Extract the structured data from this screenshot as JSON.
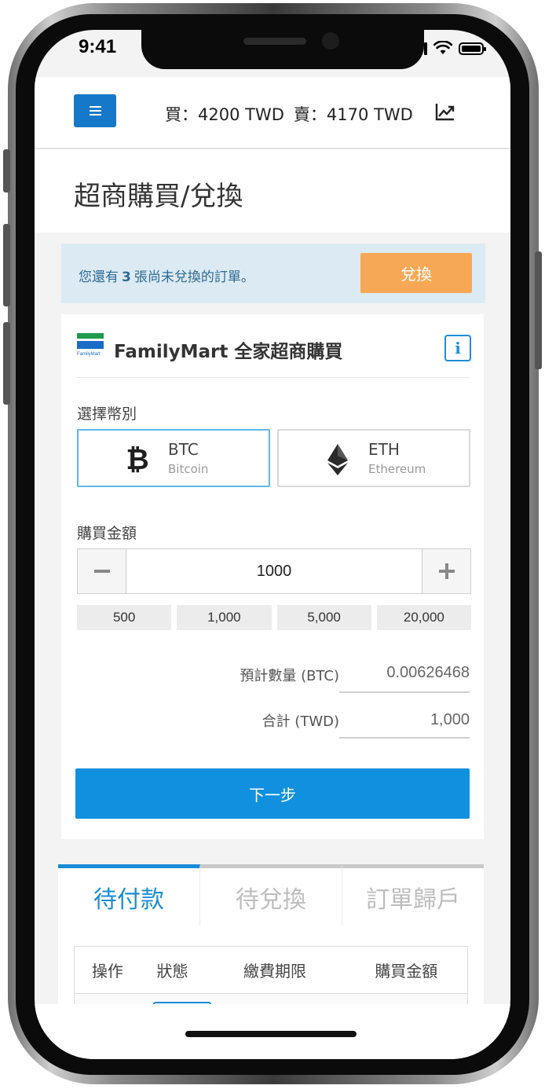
{
  "status_bar": {
    "time": "9:41"
  },
  "header": {
    "buy_rate": "買：4200 TWD",
    "sell_rate": "賣：4170 TWD"
  },
  "page": {
    "title": "超商購買/兌換"
  },
  "alert": {
    "text_before": "您還有",
    "count": "3",
    "text_after": "張尚未兌換的訂單。",
    "exchange_label": "兌換"
  },
  "card": {
    "logo_text": "FamilyMart",
    "title": "FamilyMart 全家超商購買",
    "info_glyph": "i",
    "currency_label": "選擇幣別",
    "currencies": [
      {
        "code": "BTC",
        "name": "Bitcoin",
        "selected": true
      },
      {
        "code": "ETH",
        "name": "Ethereum",
        "selected": false
      }
    ],
    "amount_label": "購買金額",
    "amount_value": "1000",
    "presets": [
      "500",
      "1,000",
      "5,000",
      "20,000"
    ],
    "estimate_label": "預計數量 (BTC)",
    "estimate_value": "0.00626468",
    "total_label": "合計 (TWD)",
    "total_value": "1,000",
    "next_label": "下一步"
  },
  "tabs": [
    {
      "label": "待付款",
      "active": true
    },
    {
      "label": "待兌換",
      "active": false
    },
    {
      "label": "訂單歸戶",
      "active": false
    }
  ],
  "table": {
    "columns": [
      "操作",
      "狀態",
      "繳費期限",
      "購買金額"
    ]
  },
  "colors": {
    "primary": "#1190df",
    "header_button": "#1678c8",
    "exchange_button": "#f7a856",
    "alert_bg": "#dceaf3",
    "alert_text": "#2d6a95",
    "active_tab": "#1a8cd6"
  },
  "icons": {
    "menu": "hamburger-icon",
    "trend": "trend-chart-icon",
    "info": "info-icon",
    "btc": "bitcoin-icon",
    "eth": "ethereum-icon",
    "minus": "minus-icon",
    "plus": "plus-icon"
  }
}
